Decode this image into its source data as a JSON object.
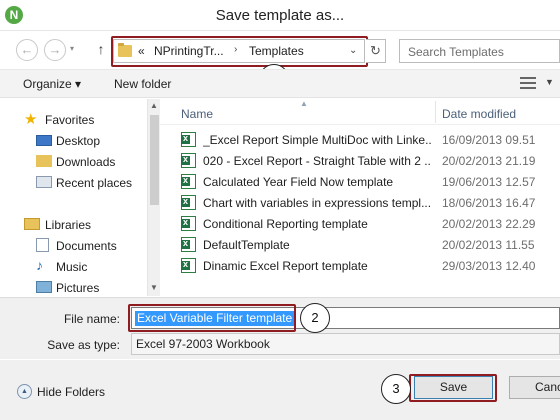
{
  "window": {
    "title": "Save template as...",
    "app_logo_text": "N"
  },
  "nav": {
    "back": "←",
    "forward": "→",
    "up": "↑",
    "address_segments": [
      "«",
      "NPrintingTr...",
      "›",
      "Templates"
    ],
    "address_dropdown": "⌄",
    "refresh": "↻",
    "search_placeholder": "Search Templates"
  },
  "toolbar": {
    "organize": "Organize ▾",
    "new_folder": "New folder"
  },
  "sidebar": {
    "favorites_label": "Favorites",
    "favorites": [
      "Desktop",
      "Downloads",
      "Recent places"
    ],
    "libraries_label": "Libraries",
    "libraries": [
      "Documents",
      "Music",
      "Pictures"
    ]
  },
  "filelist": {
    "columns": {
      "name": "Name",
      "date": "Date modified"
    },
    "rows": [
      {
        "name": "_Excel Report Simple MultiDoc with Linke...",
        "date": "16/09/2013 09.51"
      },
      {
        "name": "020 - Excel Report - Straight Table with 2 ...",
        "date": "20/02/2013 21.19"
      },
      {
        "name": "Calculated Year Field Now template",
        "date": "19/06/2013 12.57"
      },
      {
        "name": "Chart with variables in expressions templ...",
        "date": "18/06/2013 16.47"
      },
      {
        "name": "Conditional Reporting template",
        "date": "20/02/2013 22.29"
      },
      {
        "name": "DefaultTemplate",
        "date": "20/02/2013 11.55"
      },
      {
        "name": "Dinamic Excel Report template",
        "date": "29/03/2013 12.40"
      }
    ]
  },
  "fields": {
    "file_name_label": "File name:",
    "file_name_value": "Excel Variable Filter template",
    "save_as_type_label": "Save as type:",
    "save_as_type_value": "Excel 97-2003 Workbook"
  },
  "buttons": {
    "hide_folders": "Hide Folders",
    "save": "Save",
    "cancel": "Canc"
  },
  "callouts": [
    "1",
    "2",
    "3"
  ],
  "colors": {
    "highlight": "#8e1c20",
    "selection": "#3399ff",
    "excel_green": "#207245"
  }
}
